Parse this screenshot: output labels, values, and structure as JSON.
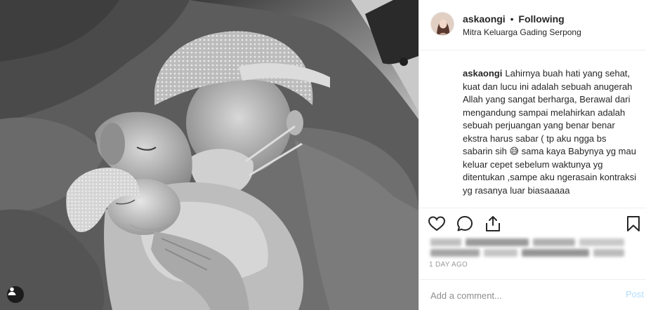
{
  "post": {
    "header": {
      "username": "askaongi",
      "separator": "•",
      "follow_status": "Following",
      "location": "Mitra Keluarga Gading Serpong"
    },
    "caption": {
      "username": "askaongi",
      "text": "Lahirnya buah hati yang sehat, kuat dan lucu ini adalah sebuah anugerah Allah yang sangat berharga, Berawal dari mengandung sampai melahirkan adalah sebuah perjuangan yang benar benar ekstra harus sabar ( tp aku ngga bs sabarin sih 😅 sama kaya Babynya yg mau keluar cepet sebelum waktunya yg ditentukan ,sampe aku ngerasain kontraksi yg rasanya luar biasaaaaa"
    },
    "actions": {
      "icons": [
        "heart-icon",
        "comment-icon",
        "share-icon",
        "bookmark-icon"
      ]
    },
    "timestamp": "1 DAY AGO",
    "comment_box": {
      "placeholder": "Add a comment...",
      "post_label": "Post"
    }
  },
  "colors": {
    "text": "#262626",
    "secondary": "#8e8e8e",
    "post_button": "#b2dffc",
    "divider": "#efefef"
  }
}
